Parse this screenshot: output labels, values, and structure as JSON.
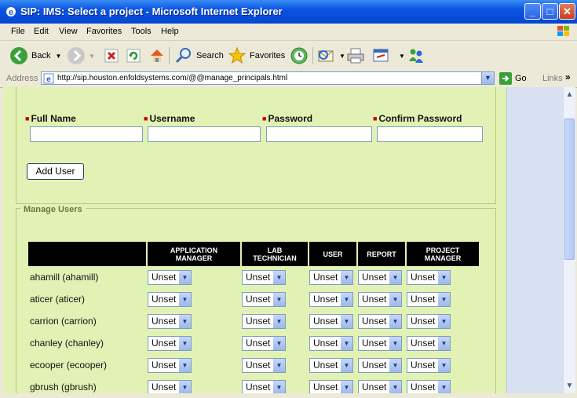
{
  "window": {
    "title": "SIP: IMS: Select a project - Microsoft Internet Explorer"
  },
  "menu": {
    "items": [
      "File",
      "Edit",
      "View",
      "Favorites",
      "Tools",
      "Help"
    ]
  },
  "toolbar": {
    "back": "Back",
    "search": "Search",
    "favorites": "Favorites"
  },
  "address": {
    "label": "Address",
    "url": "http://sip.houston.enfoldsystems.com/@@manage_principals.html",
    "go": "Go",
    "links": "Links",
    "more": "»"
  },
  "add_user": {
    "fields": [
      {
        "label": "Full Name"
      },
      {
        "label": "Username"
      },
      {
        "label": "Password"
      },
      {
        "label": "Confirm Password"
      }
    ],
    "button": "Add User"
  },
  "manage": {
    "legend": "Manage Users",
    "columns": [
      {
        "line1": "",
        "line2": ""
      },
      {
        "line1": "APPLICATION",
        "line2": "MANAGER"
      },
      {
        "line1": "LAB",
        "line2": "TECHNICIAN"
      },
      {
        "line1": "USER",
        "line2": ""
      },
      {
        "line1": "REPORT",
        "line2": ""
      },
      {
        "line1": "PROJECT",
        "line2": "MANAGER"
      }
    ],
    "rows": [
      {
        "name": "ahamill (ahamill)",
        "roles": [
          "Unset",
          "Unset",
          "Unset",
          "Unset",
          "Unset"
        ]
      },
      {
        "name": "aticer (aticer)",
        "roles": [
          "Unset",
          "Unset",
          "Unset",
          "Unset",
          "Unset"
        ]
      },
      {
        "name": "carrion (carrion)",
        "roles": [
          "Unset",
          "Unset",
          "Unset",
          "Unset",
          "Unset"
        ]
      },
      {
        "name": "chanley (chanley)",
        "roles": [
          "Unset",
          "Unset",
          "Unset",
          "Unset",
          "Unset"
        ]
      },
      {
        "name": "ecooper (ecooper)",
        "roles": [
          "Unset",
          "Unset",
          "Unset",
          "Unset",
          "Unset"
        ]
      },
      {
        "name": "gbrush (gbrush)",
        "roles": [
          "Unset",
          "Unset",
          "Unset",
          "Unset",
          "Unset"
        ]
      }
    ]
  },
  "icons": {
    "back": "back-arrow-icon",
    "forward": "forward-arrow-icon",
    "stop": "stop-icon",
    "refresh": "refresh-icon",
    "home": "home-icon",
    "search": "search-icon",
    "favorites": "favorites-star-icon",
    "history": "history-icon",
    "mail": "mail-icon",
    "print": "print-icon",
    "edit": "edit-icon",
    "messenger": "messenger-icon"
  },
  "colors": {
    "content_bg": "#e2f2b5",
    "header_bg": "#000000",
    "required_marker": "#cc0000",
    "titlebar": "#0a55e0"
  }
}
